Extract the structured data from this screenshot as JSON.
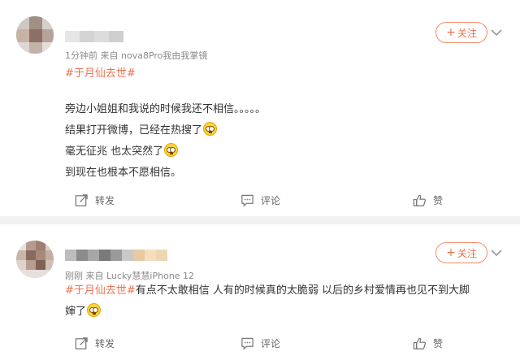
{
  "posts": [
    {
      "meta": "1分钟前  来自 nova8Pro我由我掌镜",
      "topic": "#于月仙去世#",
      "lines": [
        {
          "text": "旁边小姐姐和我说的时候我还不相信。。。。。",
          "emoji": false
        },
        {
          "text": "结果打开微博，已经在热搜了",
          "emoji": true
        },
        {
          "text": "毫无征兆 也太突然了",
          "emoji": true
        },
        {
          "text": "到现在也根本不愿相信。",
          "emoji": false
        }
      ],
      "follow_label": "关注",
      "actions": {
        "repost": "转发",
        "comment": "评论",
        "like": "赞"
      }
    },
    {
      "meta": "刚刚  来自 Lucky慧慧iPhone 12",
      "topic": "#于月仙去世#",
      "line1_rest": "有点不太敢相信 人有的时候真的太脆弱 以后的乡村爱情再也见不到大脚",
      "line2": "婶了",
      "follow_label": "关注",
      "actions": {
        "repost": "转发",
        "comment": "评论",
        "like": "赞"
      }
    }
  ],
  "icons": {
    "repost": "repost-icon",
    "comment": "comment-icon",
    "like": "thumbs-up-icon",
    "more": "chevron-down-icon"
  },
  "colors": {
    "accent": "#eb7350",
    "follow_border": "#f58c6e",
    "text": "#333333",
    "meta": "#8a8a8a",
    "background": "#f2f2f2"
  }
}
